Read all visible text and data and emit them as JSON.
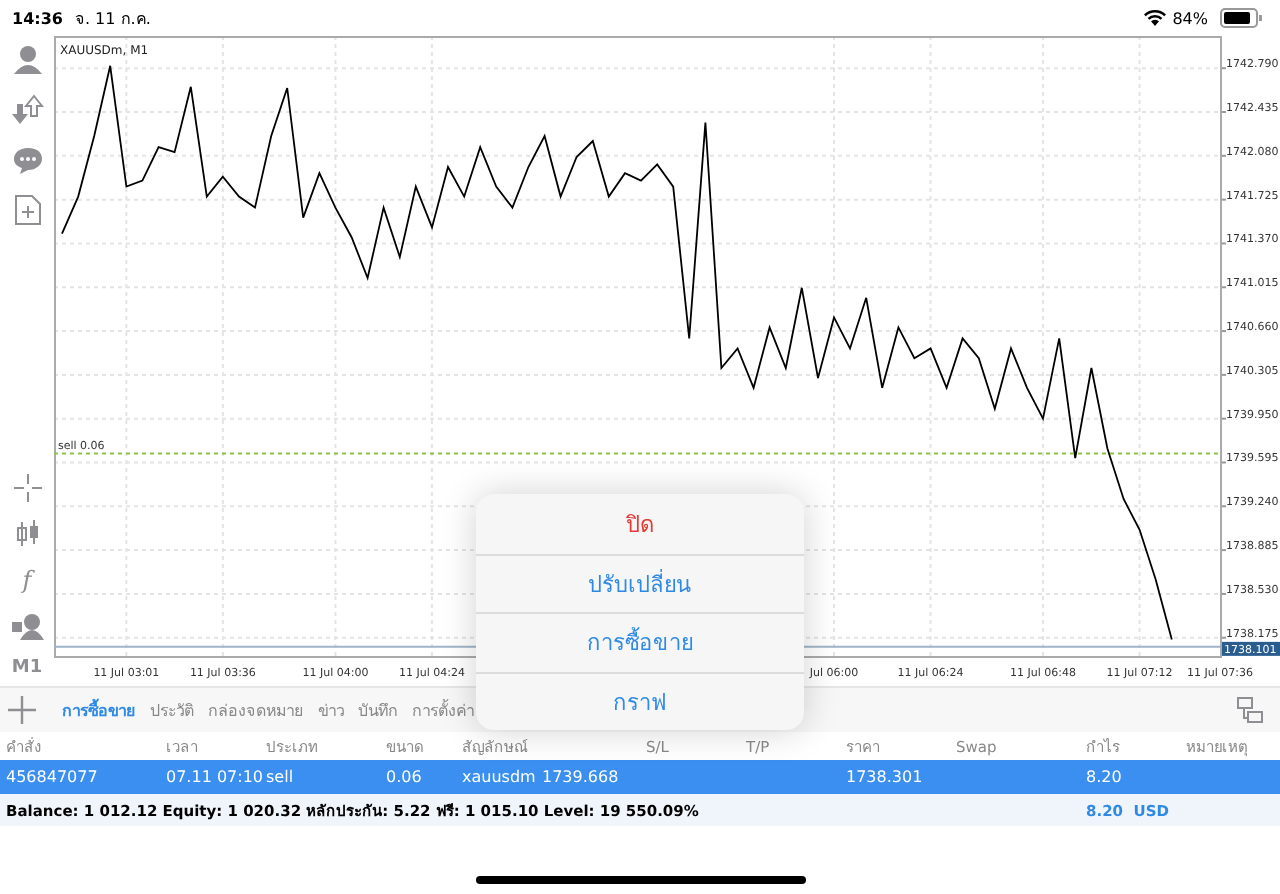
{
  "status_bar": {
    "time": "14:36",
    "date": "จ. 11 ก.ค.",
    "battery": "84%"
  },
  "left_toolbar": {
    "function_glyph": "f",
    "timeframe": "M1"
  },
  "chart": {
    "title": "XAUUSDm, M1",
    "chart_data": {
      "type": "line",
      "grid": true,
      "ylim": [
        1738.027,
        1743.051
      ],
      "categories": [
        null,
        null,
        null,
        null,
        "11 Jul 03:01",
        null,
        null,
        null,
        null,
        null,
        "11 Jul 03:36",
        null,
        null,
        null,
        null,
        null,
        null,
        "11 Jul 04:00",
        null,
        null,
        null,
        null,
        null,
        "11 Jul 04:24",
        null,
        null,
        null,
        null,
        null,
        null,
        null,
        null,
        null,
        null,
        null,
        null,
        null,
        null,
        null,
        null,
        null,
        null,
        null,
        null,
        null,
        null,
        null,
        null,
        "Jul 06:00",
        null,
        null,
        null,
        null,
        null,
        "11 Jul 06:24",
        null,
        null,
        null,
        null,
        null,
        null,
        "11 Jul 06:48",
        null,
        null,
        null,
        null,
        null,
        "11 Jul 07:12",
        null,
        null,
        null,
        null,
        "11 Jul 07:36"
      ],
      "series": [
        {
          "color": "#000000",
          "values": [
            1741.45,
            1741.75,
            1742.24,
            1742.81,
            1741.83,
            1741.88,
            1742.15,
            1742.11,
            1742.64,
            1741.75,
            1741.91,
            1741.75,
            1741.66,
            1742.24,
            1742.63,
            1741.58,
            1741.94,
            1741.66,
            1741.42,
            1741.09,
            1741.66,
            1741.26,
            1741.83,
            1741.5,
            1741.99,
            1741.75,
            1742.15,
            1741.83,
            1741.66,
            1741.99,
            1742.24,
            1741.75,
            1742.07,
            1742.2,
            1741.75,
            1741.94,
            1741.88,
            1742.01,
            1741.83,
            1740.6,
            1742.35,
            1740.36,
            1740.52,
            1740.2,
            1740.69,
            1740.36,
            1741.01,
            1740.28,
            1740.77,
            1740.52,
            1740.93,
            1740.2,
            1740.69,
            1740.44,
            1740.52,
            1740.2,
            1740.6,
            1740.44,
            1740.03,
            1740.52,
            1740.2,
            1739.95,
            1740.6,
            1739.63,
            1740.36,
            1739.71,
            1739.3,
            1739.05,
            1738.65,
            1738.16,
            null,
            null,
            null
          ]
        }
      ],
      "yticks": [
        {
          "value": 1742.79,
          "label": "1742.790"
        },
        {
          "value": 1742.435,
          "label": "1742.435"
        },
        {
          "value": 1742.08,
          "label": "1742.080"
        },
        {
          "value": 1741.725,
          "label": "1741.725"
        },
        {
          "value": 1741.37,
          "label": "1741.370"
        },
        {
          "value": 1741.015,
          "label": "1741.015"
        },
        {
          "value": 1740.66,
          "label": "1740.660"
        },
        {
          "value": 1740.305,
          "label": "1740.305"
        },
        {
          "value": 1739.95,
          "label": "1739.950"
        },
        {
          "value": 1739.595,
          "label": "1739.595"
        },
        {
          "value": 1739.24,
          "label": "1739.240"
        },
        {
          "value": 1738.885,
          "label": "1738.885"
        },
        {
          "value": 1738.53,
          "label": "1738.530"
        },
        {
          "value": 1738.175,
          "label": "1738.175"
        }
      ],
      "ref_lines": [
        {
          "axis": "y",
          "value": 1739.668,
          "label": "sell 0.06",
          "color": "#8bc34a"
        },
        {
          "axis": "y",
          "value": 1738.101,
          "label": "1738.101",
          "color": "#9fb4c8"
        }
      ]
    }
  },
  "tabs": [
    {
      "label": "การซื้อขาย",
      "selected": true
    },
    {
      "label": "ประวัติ",
      "selected": false
    },
    {
      "label": "กล่องจดหมาย",
      "selected": false
    },
    {
      "label": "ข่าว",
      "selected": false
    },
    {
      "label": "บันทึก",
      "selected": false
    },
    {
      "label": "การตั้งค่า",
      "selected": false
    }
  ],
  "table": {
    "columns": [
      "คำสั่ง",
      "เวลา",
      "ประเภท",
      "ขนาด",
      "สัญลักษณ์",
      null,
      "S/L",
      "T/P",
      "ราคา",
      "Swap",
      "กำไร",
      "หมายเหตุ"
    ],
    "rows": [
      {
        "selected": true,
        "cells": [
          "456847077",
          "07.11 07:10",
          "sell",
          "0.06",
          "xauusdm",
          "1739.668",
          null,
          null,
          "1738.301",
          null,
          "8.20",
          null
        ]
      }
    ]
  },
  "summary": {
    "text": "Balance: 1 012.12 Equity: 1 020.32 หลักประกัน: 5.22 ฟรี: 1 015.10 Level: 19 550.09%",
    "profit": "8.20  USD"
  },
  "context_menu": {
    "items": [
      {
        "label": "ปิด",
        "kind": "destructive"
      },
      {
        "label": "ปรับเปลี่ยน",
        "kind": "default"
      },
      {
        "label": "การซื้อขาย",
        "kind": "default"
      },
      {
        "label": "กราฟ",
        "kind": "default"
      }
    ]
  }
}
